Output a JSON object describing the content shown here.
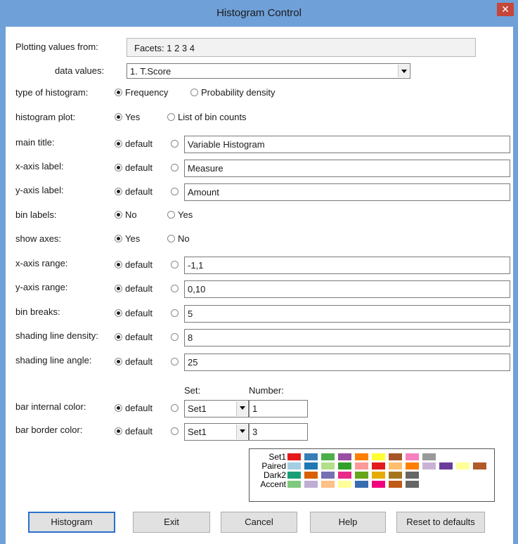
{
  "window": {
    "title": "Histogram Control",
    "close_symbol": "✕"
  },
  "form": {
    "plotting_values_from_label": "Plotting values from:",
    "plotting_values_from_value": "Facets: 1 2 3 4",
    "data_values_label": "data values:",
    "data_values_selected": "1. T.Score",
    "type_of_histogram_label": "type of histogram:",
    "type_opt1": "Frequency",
    "type_opt2": "Probability density",
    "histogram_plot_label": "histogram plot:",
    "plot_opt1": "Yes",
    "plot_opt2": "List of bin counts",
    "main_title_label": "main title:",
    "main_title_value": "Variable Histogram",
    "xaxis_label_label": "x-axis label:",
    "xaxis_label_value": "Measure",
    "yaxis_label_label": "y-axis label:",
    "yaxis_label_value": "Amount",
    "bin_labels_label": "bin labels:",
    "bin_labels_opt1": "No",
    "bin_labels_opt2": "Yes",
    "show_axes_label": "show axes:",
    "show_axes_opt1": "Yes",
    "show_axes_opt2": "No",
    "xaxis_range_label": "x-axis range:",
    "xaxis_range_value": "-1,1",
    "yaxis_range_label": "y-axis range:",
    "yaxis_range_value": "0,10",
    "bin_breaks_label": "bin breaks:",
    "bin_breaks_value": "5",
    "shading_density_label": "shading line density:",
    "shading_density_value": "8",
    "shading_angle_label": "shading line angle:",
    "shading_angle_value": "25",
    "default_text": "default",
    "set_header": "Set:",
    "number_header": "Number:",
    "bar_internal_label": "bar internal color:",
    "bar_internal_set": "Set1",
    "bar_internal_number": "1",
    "bar_border_label": "bar border color:",
    "bar_border_set": "Set1",
    "bar_border_number": "3"
  },
  "palettes": [
    {
      "name": "Set1",
      "colors": [
        "#e41a1c",
        "#377eb8",
        "#4daf4a",
        "#984ea3",
        "#ff7f00",
        "#ffff33",
        "#a65628",
        "#f781bf",
        "#999999"
      ]
    },
    {
      "name": "Paired",
      "colors": [
        "#a6cee3",
        "#1f78b4",
        "#b2df8a",
        "#33a02c",
        "#fb9a99",
        "#e31a1c",
        "#fdbf6f",
        "#ff7f00",
        "#cab2d6",
        "#6a3d9a",
        "#ffff99",
        "#b15928"
      ]
    },
    {
      "name": "Dark2",
      "colors": [
        "#1b9e77",
        "#d95f02",
        "#7570b3",
        "#e7298a",
        "#66a61e",
        "#e6ab02",
        "#a6761d",
        "#666666"
      ]
    },
    {
      "name": "Accent",
      "colors": [
        "#7fc97f",
        "#beaed4",
        "#fdc086",
        "#ffff99",
        "#386cb0",
        "#f0027f",
        "#bf5b17",
        "#666666"
      ]
    }
  ],
  "buttons": {
    "histogram": "Histogram",
    "exit": "Exit",
    "cancel": "Cancel",
    "help": "Help",
    "reset": "Reset to defaults"
  },
  "colors": {
    "titlebar": "#6fa0d8",
    "close": "#c6463b",
    "default_button_border": "#2a6fcf"
  }
}
